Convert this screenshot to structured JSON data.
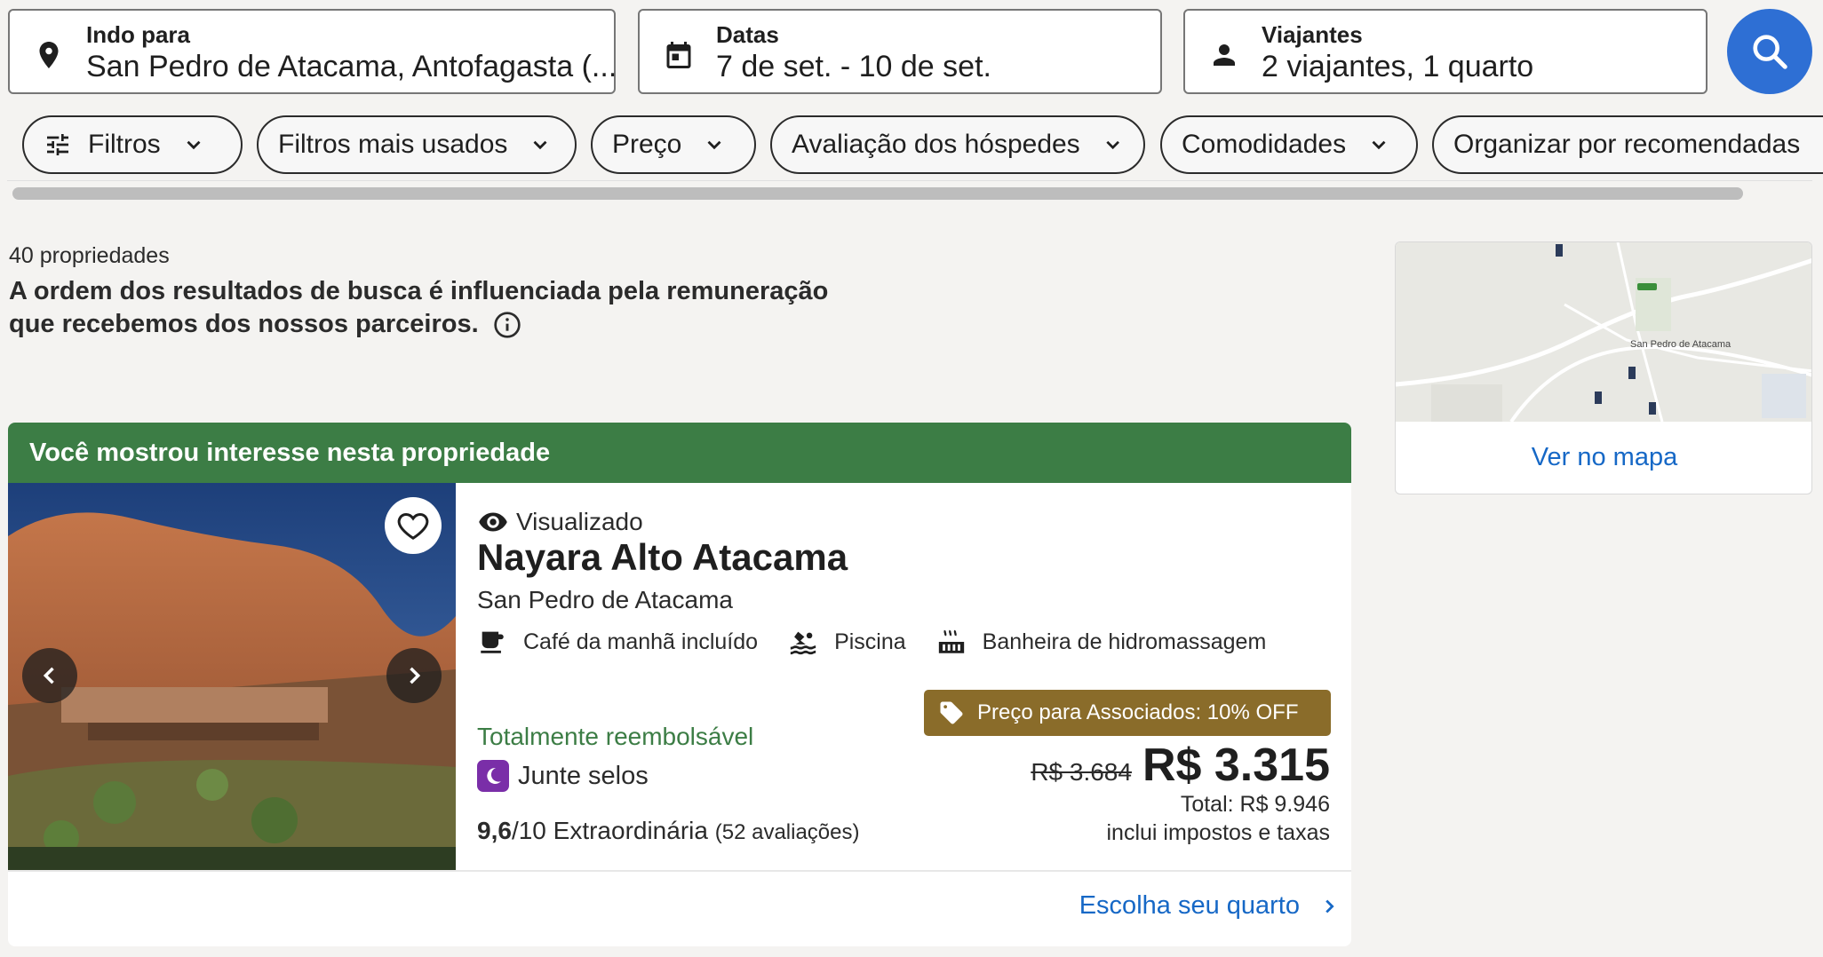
{
  "search": {
    "destination": {
      "label": "Indo para",
      "value": "San Pedro de Atacama, Antofagasta (..."
    },
    "dates": {
      "label": "Datas",
      "value": "7 de set. - 10 de set."
    },
    "travelers": {
      "label": "Viajantes",
      "value": "2 viajantes, 1 quarto"
    },
    "search_icon": "search-icon"
  },
  "filters": [
    {
      "label": "Filtros"
    },
    {
      "label": "Filtros mais usados"
    },
    {
      "label": "Preço"
    },
    {
      "label": "Avaliação dos hóspedes"
    },
    {
      "label": "Comodidades"
    },
    {
      "label": "Organizar por recomendadas"
    }
  ],
  "results": {
    "count": "40 propriedades",
    "disclaimer": "A ordem dos resultados de busca é influenciada pela remuneração que recebemos dos nossos parceiros."
  },
  "map": {
    "place_label": "San Pedro de Atacama",
    "link": "Ver no mapa"
  },
  "property": {
    "banner": "Você mostrou interesse nesta propriedade",
    "viewed": "Visualizado",
    "name": "Nayara Alto Atacama",
    "location": "San Pedro de Atacama",
    "amenities": [
      "Café da manhã incluído",
      "Piscina",
      "Banheira de hidromassagem"
    ],
    "refundable": "Totalmente reembolsável",
    "stamps": "Junte selos",
    "rating_score": "9,6",
    "rating_text": "/10 Extraordinária",
    "reviews": "(52 avaliações)",
    "member_badge": "Preço para Associados: 10% OFF",
    "old_price": "R$ 3.684",
    "price": "R$ 3.315",
    "total": "Total: R$ 9.946",
    "taxes": "inclui impostos e taxas",
    "cta": "Escolha seu quarto"
  },
  "colors": {
    "accent": "#2e6fd4",
    "link": "#1668c6",
    "banner_green": "#3c7d45",
    "member_gold": "#8a6c2a"
  }
}
